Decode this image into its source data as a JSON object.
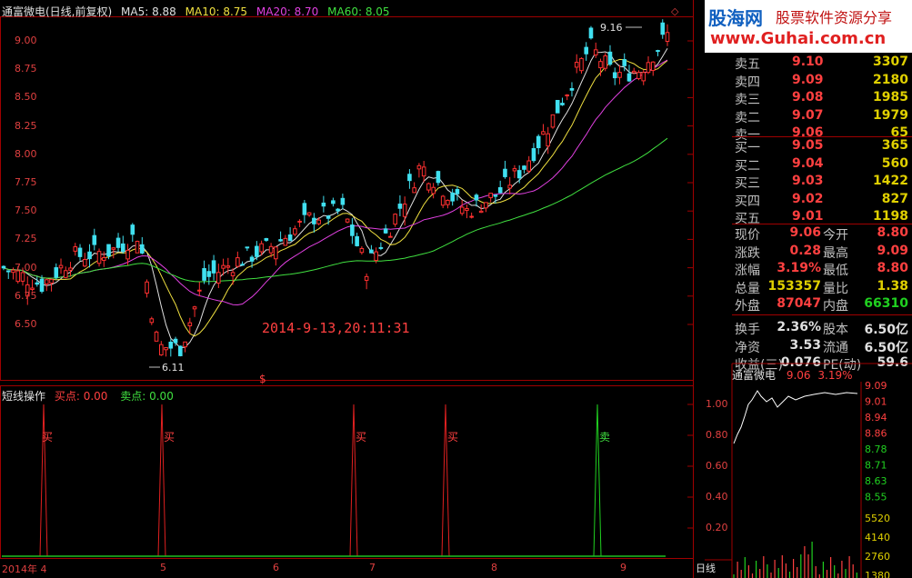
{
  "header": {
    "title": "通富微电(日线,前复权)",
    "ma5": "MA5: 8.88",
    "ma10": "MA10: 8.75",
    "ma20": "MA20: 8.70",
    "ma60": "MA60: 8.05"
  },
  "watermark": {
    "brand": "股海网",
    "slogan": "股票软件资源分享",
    "url": "www.Guhai.com.cn"
  },
  "annotations": {
    "high_label": "9.16",
    "low_label": "6.11",
    "timestamp": "2014-9-13,20:11:31",
    "marker": "$"
  },
  "price_axis": [
    "9.00",
    "8.75",
    "8.50",
    "8.25",
    "8.00",
    "7.75",
    "7.50",
    "7.25",
    "7.00",
    "6.75",
    "6.50"
  ],
  "indicator": {
    "name": "短线操作",
    "buy_label": "买点: 0.00",
    "sell_label": "卖点: 0.00",
    "axis": [
      "1.00",
      "0.80",
      "0.60",
      "0.40",
      "0.20"
    ],
    "signals": [
      {
        "text": "买",
        "type": "buy"
      },
      {
        "text": "买",
        "type": "buy"
      },
      {
        "text": "买",
        "type": "buy"
      },
      {
        "text": "买",
        "type": "buy"
      },
      {
        "text": "卖",
        "type": "sell"
      }
    ]
  },
  "time_axis": [
    "2014年 4",
    "5",
    "6",
    "7",
    "8",
    "9"
  ],
  "period_label": "日线",
  "order_book": {
    "asks": [
      {
        "label": "卖五",
        "price": "9.10",
        "volume": "3307"
      },
      {
        "label": "卖四",
        "price": "9.09",
        "volume": "2180"
      },
      {
        "label": "卖三",
        "price": "9.08",
        "volume": "1985"
      },
      {
        "label": "卖二",
        "price": "9.07",
        "volume": "1979"
      },
      {
        "label": "卖一",
        "price": "9.06",
        "volume": "65"
      }
    ],
    "bids": [
      {
        "label": "买一",
        "price": "9.05",
        "volume": "365"
      },
      {
        "label": "买二",
        "price": "9.04",
        "volume": "560"
      },
      {
        "label": "买三",
        "price": "9.03",
        "volume": "1422"
      },
      {
        "label": "买四",
        "price": "9.02",
        "volume": "827"
      },
      {
        "label": "买五",
        "price": "9.01",
        "volume": "1198"
      }
    ]
  },
  "stats": [
    {
      "l1": "现价",
      "v1": "9.06",
      "c1": "#ff4040",
      "l2": "今开",
      "v2": "8.80",
      "c2": "#ff4040"
    },
    {
      "l1": "涨跌",
      "v1": "0.28",
      "c1": "#ff4040",
      "l2": "最高",
      "v2": "9.09",
      "c2": "#ff4040"
    },
    {
      "l1": "涨幅",
      "v1": "3.19%",
      "c1": "#ff4040",
      "l2": "最低",
      "v2": "8.80",
      "c2": "#ff4040"
    },
    {
      "l1": "总量",
      "v1": "153357",
      "c1": "#e0d000",
      "l2": "量比",
      "v2": "1.38",
      "c2": "#e0d000"
    },
    {
      "l1": "外盘",
      "v1": "87047",
      "c1": "#ff4040",
      "l2": "内盘",
      "v2": "66310",
      "c2": "#20d020"
    },
    {
      "l1": "换手",
      "v1": "2.36%",
      "c1": "#e0e0e0",
      "l2": "股本",
      "v2": "6.50亿",
      "c2": "#e0e0e0"
    },
    {
      "l1": "净资",
      "v1": "3.53",
      "c1": "#e0e0e0",
      "l2": "流通",
      "v2": "6.50亿",
      "c2": "#e0e0e0"
    },
    {
      "l1": "收益(三)",
      "v1": "0.076",
      "c1": "#e0e0e0",
      "l2": "PE(动)",
      "v2": "59.6",
      "c2": "#e0e0e0"
    }
  ],
  "mini": {
    "name": "通富微电",
    "price": "9.06",
    "change": "3.19%",
    "axis": [
      "9.09",
      "9.01",
      "8.94",
      "8.86",
      "8.78",
      "8.71",
      "8.63",
      "8.55"
    ],
    "vol_axis": [
      "5520",
      "4140",
      "2760",
      "1380"
    ]
  },
  "colors": {
    "up": "#ff3030",
    "down": "#40e0f0",
    "ma5": "#e0e0e0",
    "ma10": "#f0e040",
    "ma20": "#e040e0",
    "ma60": "#40e040"
  }
}
